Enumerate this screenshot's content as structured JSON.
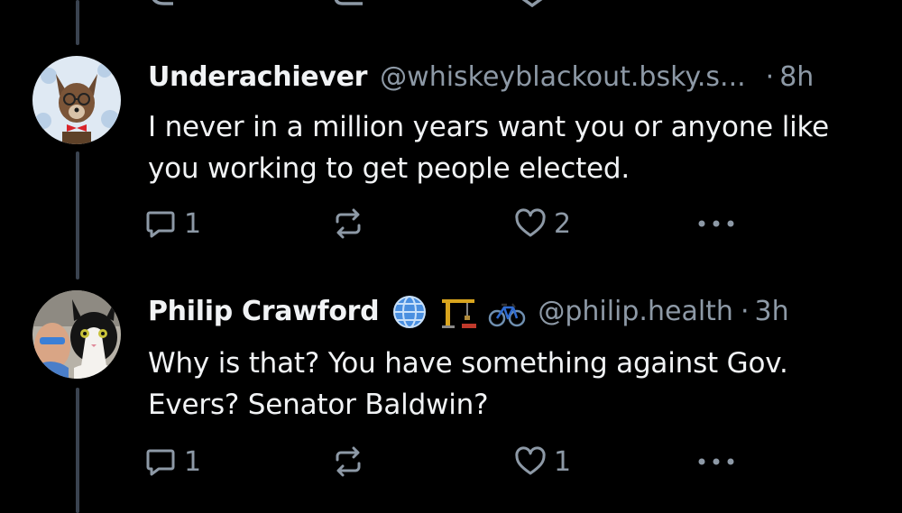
{
  "posts": [
    {
      "author_name": "Underachiever",
      "handle": "@whiskeyblackout.bsky.s...",
      "separator": "·",
      "time": "8h",
      "text": "I never in a million years want you or anyone like you working to get people elected.",
      "reply_count": "1",
      "repost_count": "",
      "like_count": "2",
      "avatar_icon": "dog-with-glasses-and-bowtie-avatar"
    },
    {
      "author_name": "Philip Crawford",
      "name_emojis": [
        "globe-emoji",
        "construction-crane-emoji",
        "bicycle-emoji"
      ],
      "handle": "@philip.health",
      "separator": "·",
      "time": "3h",
      "text": "Why is that? You have something against Gov. Evers? Senator Baldwin?",
      "reply_count": "1",
      "repost_count": "",
      "like_count": "1",
      "avatar_icon": "man-with-cat-avatar"
    }
  ],
  "colors": {
    "background": "#000000",
    "primary_text": "#f1f3f5",
    "secondary_text": "#8d99a6",
    "thread_line": "#3a4350"
  }
}
